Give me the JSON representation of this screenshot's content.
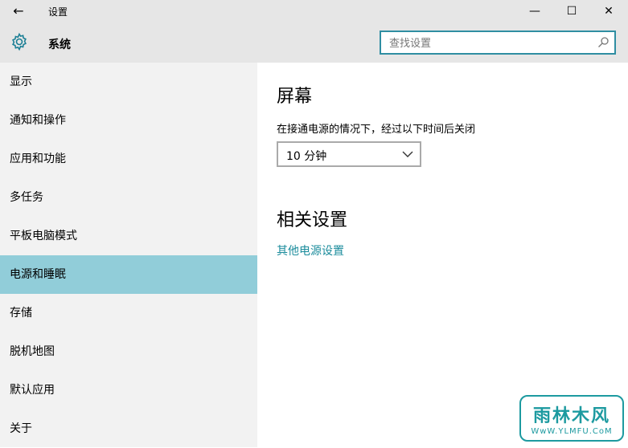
{
  "titlebar": {
    "title": "设置",
    "minimize_glyph": "—",
    "maximize_glyph": "☐",
    "close_glyph": "✕",
    "back_glyph": "←"
  },
  "header": {
    "title": "系统",
    "icon": "gear-icon",
    "search_placeholder": "查找设置"
  },
  "sidebar": {
    "items": [
      {
        "label": "显示"
      },
      {
        "label": "通知和操作"
      },
      {
        "label": "应用和功能"
      },
      {
        "label": "多任务"
      },
      {
        "label": "平板电脑模式"
      },
      {
        "label": "电源和睡眠",
        "active": true
      },
      {
        "label": "存储"
      },
      {
        "label": "脱机地图"
      },
      {
        "label": "默认应用"
      },
      {
        "label": "关于"
      }
    ]
  },
  "main": {
    "screen_heading": "屏幕",
    "screen_desc": "在接通电源的情况下，经过以下时间后关闭",
    "screen_timeout_value": "10 分钟",
    "related_heading": "相关设置",
    "related_link": "其他电源设置"
  },
  "watermark": {
    "text": "雨林木风",
    "url": "WwW.YLMFU.CoM"
  },
  "colors": {
    "accent": "#2f8ea2",
    "active_item": "#91cdd9",
    "link": "#1b8c9c"
  }
}
